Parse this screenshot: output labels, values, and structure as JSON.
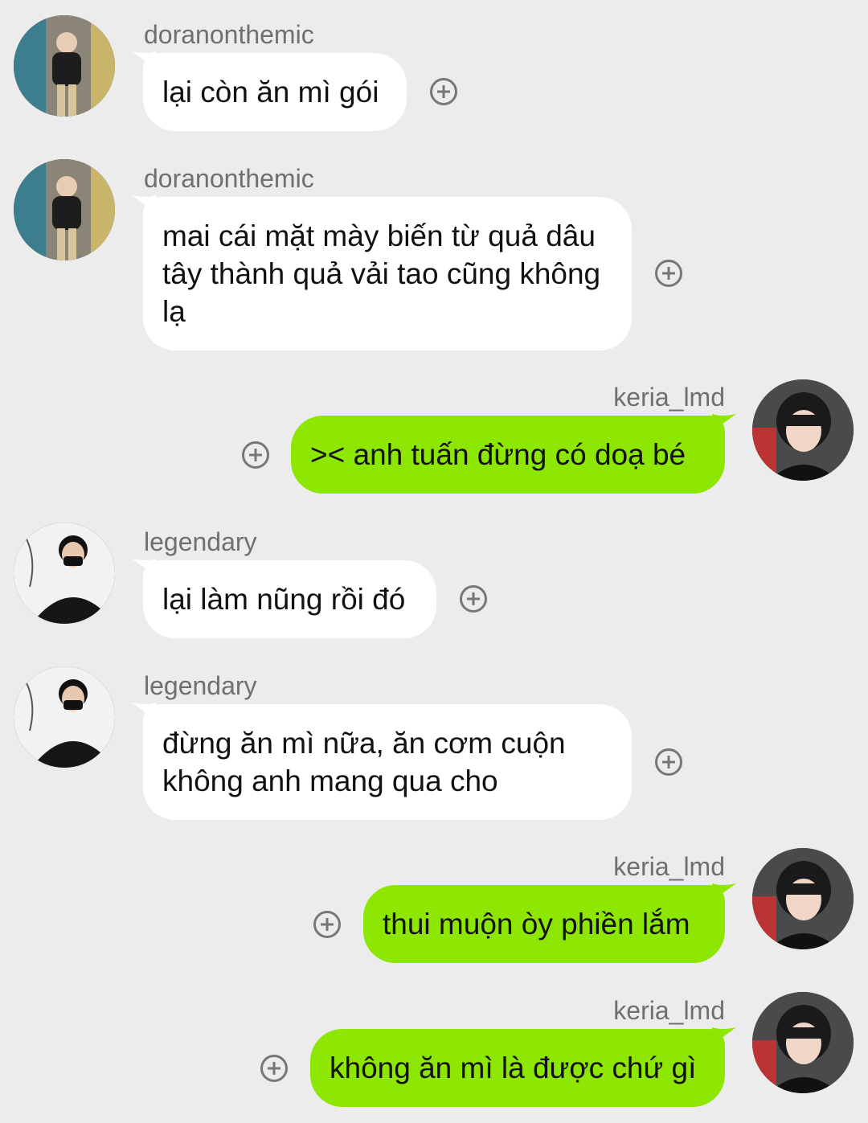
{
  "conversation": [
    {
      "sender": "doranonthemic",
      "avatar": "doran-avatar",
      "text": "lại còn ăn mì gói"
    },
    {
      "sender": "doranonthemic",
      "avatar": "doran-avatar",
      "text": "mai cái mặt mày biến từ quả dâu tây thành quả vải tao cũng không lạ"
    },
    {
      "sender": "keria_lmd",
      "avatar": "keria-avatar",
      "text": ">< anh tuấn đừng có doạ bé"
    },
    {
      "sender": "legendary",
      "avatar": "legendary-avatar",
      "text": "lại làm nũng rồi đó"
    },
    {
      "sender": "legendary",
      "avatar": "legendary-avatar",
      "text": "đừng ăn mì nữa, ăn cơm cuộn không anh mang qua cho"
    },
    {
      "sender": "keria_lmd",
      "avatar": "keria-avatar",
      "text": "thui muộn òy phiền lắm"
    },
    {
      "sender": "keria_lmd",
      "avatar": "keria-avatar",
      "text": "không ăn mì là được chứ gì"
    }
  ],
  "icons": {
    "add_reaction": "plus-circle-icon"
  },
  "colors": {
    "background": "#ececec",
    "incoming_bubble": "#ffffff",
    "outgoing_bubble": "#8ee603",
    "username": "#6f6f6f"
  }
}
